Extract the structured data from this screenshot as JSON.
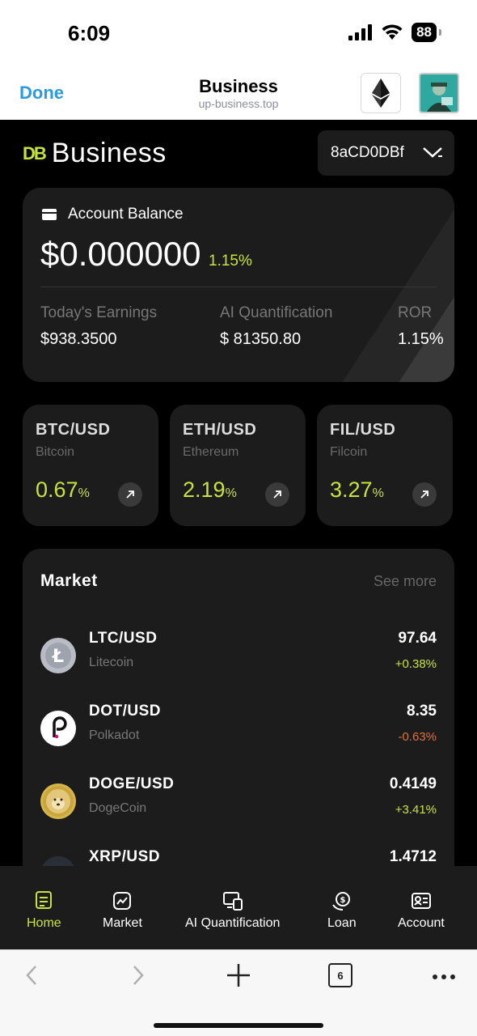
{
  "status_bar": {
    "time": "6:09",
    "battery": "88"
  },
  "browser": {
    "done_label": "Done",
    "title": "Business",
    "url": "up-business.top"
  },
  "header": {
    "brand_logo": "DB",
    "brand_name": "Business",
    "wallet_address": "8aCD0DBf"
  },
  "balance": {
    "label": "Account Balance",
    "amount": "$0.000000",
    "change": "1.15%",
    "stats": [
      {
        "label": "Today's Earnings",
        "value": "$938.3500"
      },
      {
        "label": "AI Quantification",
        "value": "$ 81350.80"
      },
      {
        "label": "ROR",
        "value": "1.15%"
      }
    ]
  },
  "tiles": [
    {
      "pair": "BTC/USD",
      "name": "Bitcoin",
      "change": "0.67",
      "unit": "%"
    },
    {
      "pair": "ETH/USD",
      "name": "Ethereum",
      "change": "2.19",
      "unit": "%"
    },
    {
      "pair": "FIL/USD",
      "name": "Filcoin",
      "change": "3.27",
      "unit": "%"
    }
  ],
  "market": {
    "title": "Market",
    "see_more": "See more",
    "rows": [
      {
        "pair": "LTC/USD",
        "name": "Litecoin",
        "price": "97.64",
        "change": "+0.38%",
        "icon": "litecoin-icon"
      },
      {
        "pair": "DOT/USD",
        "name": "Polkadot",
        "price": "8.35",
        "change": "-0.63%",
        "icon": "polkadot-icon"
      },
      {
        "pair": "DOGE/USD",
        "name": "DogeCoin",
        "price": "0.4149",
        "change": "+3.41%",
        "icon": "dogecoin-icon"
      },
      {
        "pair": "XRP/USD",
        "name": "",
        "price": "1.4712",
        "change": "",
        "icon": "xrp-icon"
      }
    ]
  },
  "tabbar": [
    {
      "label": "Home",
      "icon": "home-icon",
      "active": true
    },
    {
      "label": "Market",
      "icon": "market-icon"
    },
    {
      "label": "AI Quantification",
      "icon": "ai-quant-icon"
    },
    {
      "label": "Loan",
      "icon": "loan-icon"
    },
    {
      "label": "Account",
      "icon": "account-icon"
    }
  ],
  "safari": {
    "tab_count": "6"
  },
  "colors": {
    "accent": "#c7e33d",
    "negative": "#e0703a",
    "card": "#1c1c1c",
    "link": "#2a9bde"
  }
}
